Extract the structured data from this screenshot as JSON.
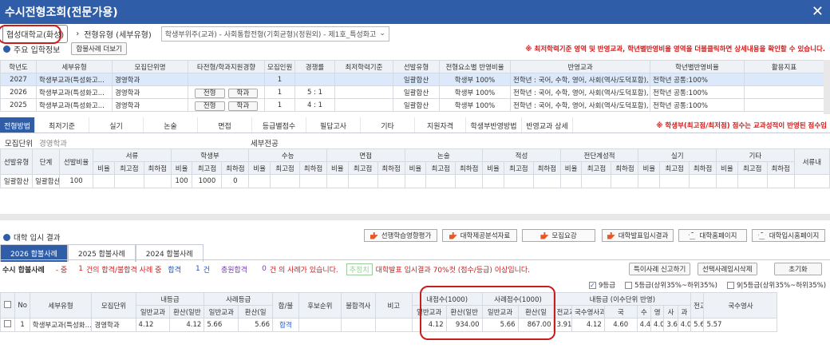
{
  "window": {
    "title": "수시전형조회(전문가용)",
    "close": "✕"
  },
  "top": {
    "university": "협성대학교(화성)",
    "arrow": "›",
    "type_label": "전형유형 (세부유형)",
    "type_value": "학생부위주(교과) - 사회통합전형(기회균형)(정원외) - 제1호_특성화고"
  },
  "info": {
    "title": "주요 입학정보",
    "more_btn": "합불사례 더보기",
    "notice": "※ 최저학력기준 영역 및 반영교과, 학년별반영비율 영역을 더블클릭하면 상세내용을 확인할 수 있습니다."
  },
  "main_headers": [
    "학년도",
    "세부유형",
    "모집단위명",
    "타전형/학과지원경향",
    "모집인원",
    "경쟁률",
    "최저학력기준",
    "선발유형",
    "전형요소별 반영비율",
    "반영교과",
    "학년별반영비율",
    "활용지표"
  ],
  "main_rows": [
    {
      "year": "2027",
      "type": "학생부교과(특성화고...",
      "unit": "경영학과",
      "b1": "",
      "b2": "",
      "cnt": "1",
      "rate": "",
      "min": "",
      "sel": "일괄합산",
      "ratio": "학생부 100%",
      "subj": "전학년 : 국어, 수학, 영어, 사회(역사/도덕포함), 과학, ...",
      "yr": "전학년 공통:100%"
    },
    {
      "year": "2026",
      "type": "학생부교과(특성화고...",
      "unit": "경영학과",
      "b1": "전형",
      "b2": "학과",
      "cnt": "1",
      "rate": "5 : 1",
      "min": "",
      "sel": "일괄합산",
      "ratio": "학생부 100%",
      "subj": "전학년 : 국어, 수학, 영어, 사회(역사/도덕포함), 과학, ...",
      "yr": "전학년 공통:100%"
    },
    {
      "year": "2025",
      "type": "학생부교과(특성화고...",
      "unit": "경영학과",
      "b1": "전형",
      "b2": "학과",
      "cnt": "1",
      "rate": "4 : 1",
      "min": "",
      "sel": "일괄합산",
      "ratio": "학생부 100%",
      "subj": "전학년 : 국어, 수학, 영어, 사회(역사/도덕포함), 과학, ...",
      "yr": "전학년 공통:100%"
    }
  ],
  "tabs": [
    "전형방법",
    "최저기준",
    "실기",
    "논술",
    "면접",
    "등급별점수",
    "필답고사",
    "기타",
    "지원자격",
    "학생부반영방법",
    "반영교과 상세"
  ],
  "tabs_notice": "※ 학생부(최고점/최저점) 점수는 교과성적이 반영된 점수임",
  "method": {
    "unit_label": "모집단위",
    "unit_value": "경영학과",
    "detail_label": "세부전공",
    "groups": [
      "서류",
      "학생부",
      "수능",
      "면접",
      "논술",
      "적성",
      "전단계성적",
      "실기",
      "기타",
      "서류내"
    ],
    "left_heads": [
      "선발유형",
      "단계",
      "선발비율"
    ],
    "sub": [
      "비율",
      "최고점",
      "최하점"
    ],
    "row": {
      "sel": "일괄합산",
      "stage": "일괄합산",
      "ratio": "100",
      "hs_ratio": "100",
      "hs_max": "1000",
      "hs_min": "0"
    }
  },
  "results": {
    "title": "대학 입시 결과",
    "buttons": [
      "선행학습영향평가",
      "대학제공분석자료",
      "모집요강",
      "대학발표입시결과",
      "대학홈페이지",
      "대학입시홈페이지"
    ],
    "subtabs": [
      "2026 합불사례",
      "2025 합불사례",
      "2024 합불사례"
    ],
    "sum_label": "수시 합불사례",
    "sum_mid": "- 중",
    "sum_n1": "1",
    "sum_t1": "건의 합격/불합격 사례 중",
    "sum_pass": "합격",
    "sum_n2": "1",
    "sum_t2": "건",
    "sum_add": "충원합격",
    "sum_n3": "0",
    "sum_t3": "건  의 사례가 있습니다.",
    "badge": "추정치",
    "sum_notice": "대학발표 입시결과 70%컷 (점수/등급) 이상입니다.",
    "report_btn": "특이사례 신고하기",
    "del_btn": "선택사례임시삭제",
    "reset_btn": "초기화",
    "opts": [
      "9등급",
      "5등급(상위35%~하위35%)",
      "9|5등급(상위35%~하위35%)"
    ]
  },
  "res_table": {
    "h1": [
      "No",
      "세부유형",
      "모집단위",
      "내등급",
      "사례등급",
      "합/불",
      "후보순위",
      "불합격사",
      "비고",
      "내점수(1000)",
      "사례점수(1000)",
      "내등급 (이수단위 반영)",
      "전교과",
      "국수영사"
    ],
    "h2": [
      "일반교과",
      "환산(일반",
      "일반교과",
      "환산(일",
      "일반교과",
      "환산(일반",
      "일반교과",
      "환산(일",
      "전교과",
      "국수영사과",
      "국",
      "수",
      "영",
      "사",
      "과"
    ],
    "row": {
      "no": "1",
      "type": "학생부교과(특성화...",
      "unit": "경영학과",
      "g1": "4.12",
      "g2": "4.12",
      "c1": "5.66",
      "c2": "5.66",
      "result": "합격",
      "s1": "4.12",
      "s2": "934.00",
      "s3": "5.66",
      "s4": "867.00",
      "d1": "3.91",
      "d2": "4.12",
      "d3": "4.60",
      "d4": "4.40",
      "d5": "4.00",
      "d6": "3.60",
      "d7": "4.00",
      "all": "5.66",
      "ksy": "5.57"
    }
  }
}
